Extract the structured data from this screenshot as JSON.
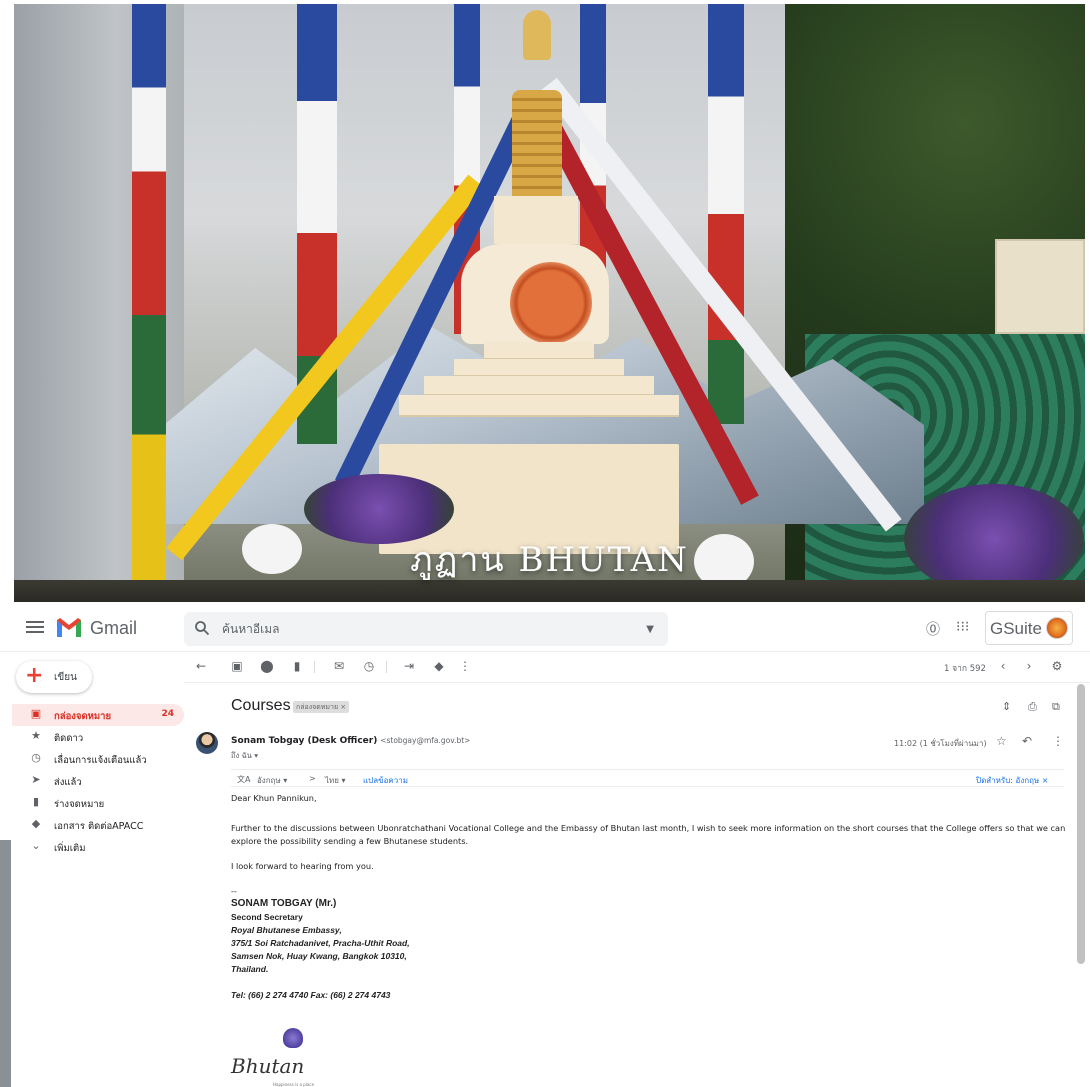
{
  "banner": {
    "title": "ภูฏาน BHUTAN"
  },
  "app": {
    "name": "Gmail",
    "brand_colors": [
      "#ea4335",
      "#4285f4",
      "#34a853",
      "#fbbc05"
    ]
  },
  "search": {
    "placeholder": "ค้นหาอีเมล"
  },
  "header": {
    "gsuite_label": "GSuite",
    "icons": [
      "help-icon",
      "apps-icon",
      "org-avatar"
    ]
  },
  "compose": {
    "label": "เขียน"
  },
  "sidebar": {
    "items": [
      {
        "label": "กล่องจดหมาย",
        "count": "24",
        "icon": "inbox-icon",
        "active": true
      },
      {
        "label": "ติดดาว",
        "count": "",
        "icon": "star-icon"
      },
      {
        "label": "เลื่อนการแจ้งเตือนแล้ว",
        "count": "",
        "icon": "clock-icon"
      },
      {
        "label": "ส่งแล้ว",
        "count": "",
        "icon": "send-icon"
      },
      {
        "label": "ร่างจดหมาย",
        "count": "",
        "icon": "draft-icon"
      },
      {
        "label": "เอกสาร ติดต่อAPACC",
        "count": "",
        "icon": "label-icon"
      },
      {
        "label": "เพิ่มเติม",
        "count": "",
        "icon": "chevron-down-icon"
      }
    ]
  },
  "toolbar": {
    "pager": "1 จาก 592"
  },
  "message": {
    "subject": "Courses",
    "label_chip": "กล่องจดหมาย ×",
    "sender_name": "Sonam Tobgay (Desk Officer)",
    "sender_email": "<stobgay@mfa.gov.bt>",
    "to_line": "ถึง ฉัน ▾",
    "time": "11:02 (1 ชั่วโมงที่ผ่านมา)",
    "translate": {
      "from_lang": "อังกฤษ ▾",
      "arrow": ">",
      "to_lang": "ไทย ▾",
      "translate_link": "แปลข้อความ",
      "off_for": "ปิดสำหรับ: อังกฤษ ×"
    },
    "greeting": "Dear Khun Pannikun,",
    "paragraph1": "Further to the discussions between Ubonratchathani Vocational College and the Embassy of Bhutan last month, I wish to seek more information on the short courses that the College offers so that we can explore the possibility sending a few Bhutanese students.",
    "paragraph2": "I look forward to hearing from you.",
    "sig_dash": "--",
    "sig_name": "SONAM TOBGAY (Mr.)",
    "sig_title": "Second Secretary",
    "sig_org": "Royal Bhutanese Embassy,",
    "sig_addr1": "375/1 Soi Ratchadanivet, Pracha-Uthit Road,",
    "sig_addr2": "Samsen Nok, Huay Kwang, Bangkok 10310,",
    "sig_country": "Thailand.",
    "sig_contact": "Tel: (66) 2 274 4740    Fax: (66) 2 274 4743",
    "logo_word": "Bhutan",
    "logo_tagline": "Happiness is a place"
  }
}
